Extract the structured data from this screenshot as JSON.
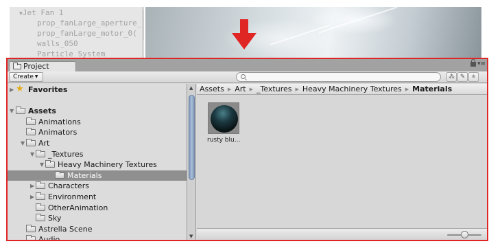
{
  "hierarchy": {
    "rows": [
      {
        "fold": "▼",
        "text": "Jet Fan 1"
      },
      {
        "fold": "",
        "text": "prop_fanLarge_aperture_"
      },
      {
        "fold": "",
        "text": "prop_fanLarge_motor_0("
      },
      {
        "fold": "",
        "text": "walls_050"
      },
      {
        "fold": "",
        "text": "Particle System"
      }
    ]
  },
  "annotation": {
    "arrow_color": "#e02525",
    "border_color": "#e02525"
  },
  "project_window": {
    "tab_label": "Project",
    "tab_menu_glyph": "▾≡",
    "toolbar": {
      "create_label": "Create",
      "search_placeholder": "",
      "filter_type_icon": "search-by-type-icon",
      "filter_label_icon": "search-by-label-icon",
      "favorite_icon": "star-icon",
      "filter_type_glyph": "⁂",
      "filter_label_glyph": "✎",
      "favorite_glyph": "★"
    },
    "tree": {
      "items": [
        {
          "label": "Favorites",
          "indent": 0,
          "fold": "▶",
          "icon": "star",
          "bold": true,
          "selected": false
        },
        {
          "label": "",
          "indent": 0,
          "fold": "",
          "icon": "",
          "bold": false,
          "selected": false
        },
        {
          "label": "Assets",
          "indent": 0,
          "fold": "▼",
          "icon": "folder",
          "bold": true,
          "selected": false
        },
        {
          "label": "Animations",
          "indent": 1,
          "fold": "",
          "icon": "folder",
          "bold": false,
          "selected": false
        },
        {
          "label": "Animators",
          "indent": 1,
          "fold": "",
          "icon": "folder",
          "bold": false,
          "selected": false
        },
        {
          "label": "Art",
          "indent": 1,
          "fold": "▼",
          "icon": "folder",
          "bold": false,
          "selected": false
        },
        {
          "label": "_Textures",
          "indent": 2,
          "fold": "▼",
          "icon": "folder",
          "bold": false,
          "selected": false
        },
        {
          "label": "Heavy Machinery Textures",
          "indent": 3,
          "fold": "▼",
          "icon": "folder",
          "bold": false,
          "selected": false
        },
        {
          "label": "Materials",
          "indent": 4,
          "fold": "",
          "icon": "folder",
          "bold": false,
          "selected": true
        },
        {
          "label": "Characters",
          "indent": 2,
          "fold": "▶",
          "icon": "folder",
          "bold": false,
          "selected": false
        },
        {
          "label": "Environment",
          "indent": 2,
          "fold": "▶",
          "icon": "folder",
          "bold": false,
          "selected": false
        },
        {
          "label": "OtherAnimation",
          "indent": 2,
          "fold": "",
          "icon": "folder",
          "bold": false,
          "selected": false
        },
        {
          "label": "Sky",
          "indent": 2,
          "fold": "",
          "icon": "folder",
          "bold": false,
          "selected": false
        },
        {
          "label": "Astrella Scene",
          "indent": 1,
          "fold": "",
          "icon": "folder",
          "bold": false,
          "selected": false
        },
        {
          "label": "Audio",
          "indent": 1,
          "fold": "",
          "icon": "folder",
          "bold": false,
          "selected": false
        }
      ]
    },
    "breadcrumb": [
      "Assets",
      "Art",
      "_Textures",
      "Heavy Machinery Textures",
      "Materials"
    ],
    "assets": [
      {
        "label": "rusty blu...",
        "type": "material"
      }
    ],
    "scroll_arrows": {
      "up": "▲",
      "down": "▼"
    }
  }
}
